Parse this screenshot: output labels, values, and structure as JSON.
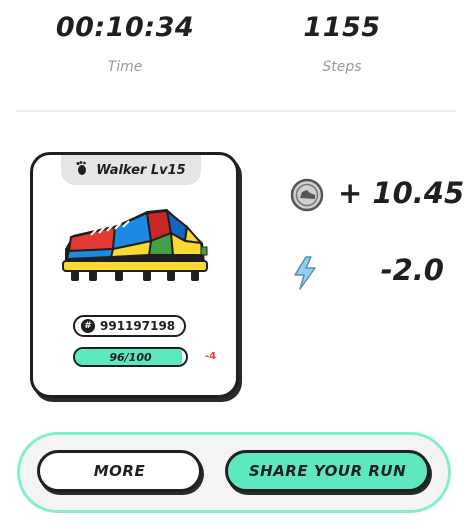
{
  "stats": {
    "time": {
      "value": "00:10:34",
      "label": "Time"
    },
    "steps": {
      "value": "1155",
      "label": "Steps"
    }
  },
  "sneaker": {
    "type_label": "Walker Lv15",
    "id": "991197198",
    "durability": {
      "text": "96/100",
      "current": 96,
      "max": 100,
      "delta": "-4"
    }
  },
  "rewards": {
    "gst": {
      "value": "+ 10.45",
      "icon": "sneaker-coin-icon"
    },
    "energy": {
      "value": "-2.0",
      "icon": "lightning-bolt-icon"
    }
  },
  "actions": {
    "more_label": "MORE",
    "share_label": "SHARE YOUR RUN"
  },
  "colors": {
    "accent": "#5ee8c0",
    "accent_border": "#7ff0cf",
    "negative": "#e53935",
    "energy": "#8fd0f0"
  }
}
